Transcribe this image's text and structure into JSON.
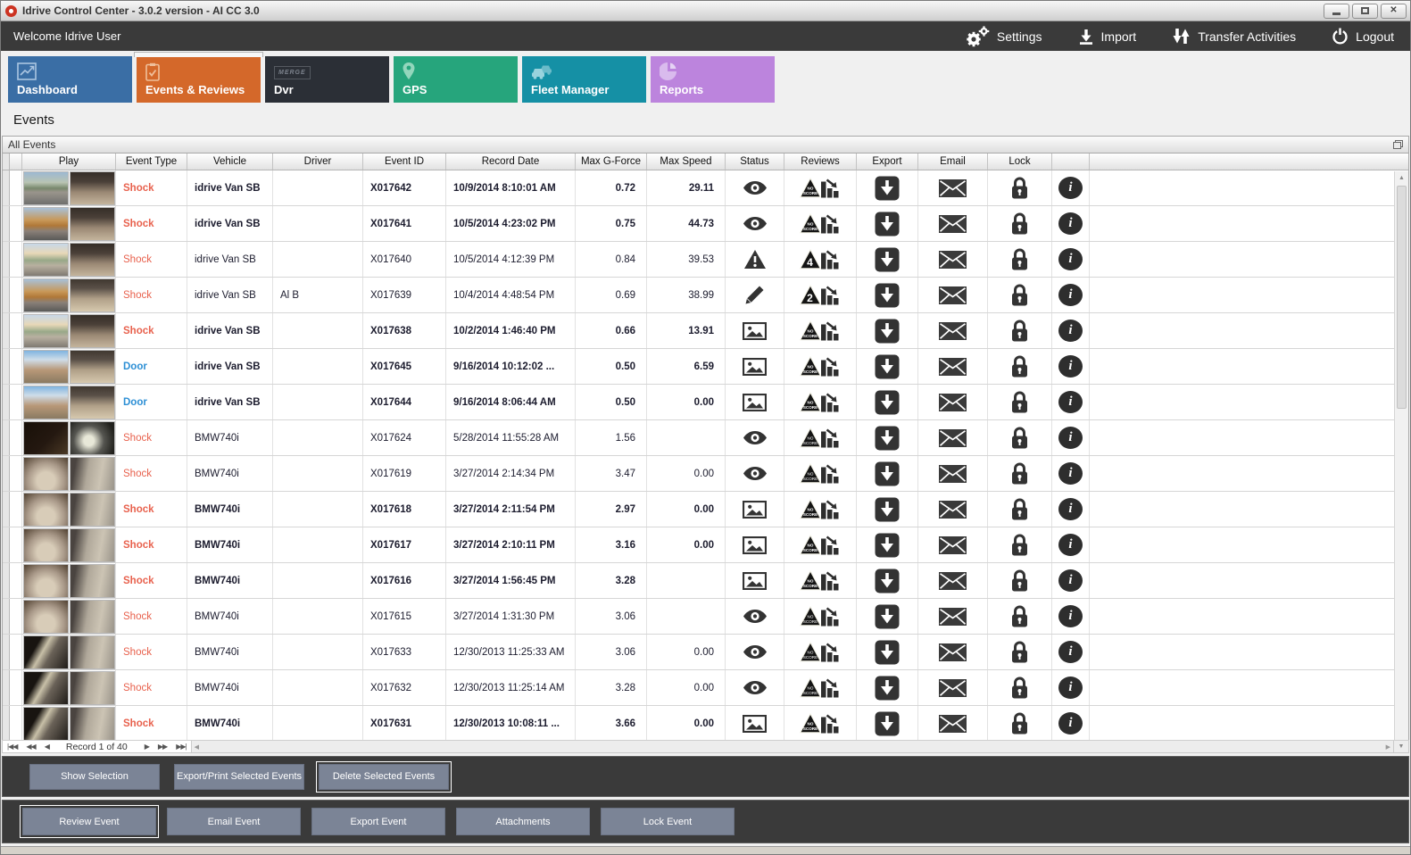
{
  "window": {
    "title": "Idrive Control Center - 3.0.2 version - AI CC 3.0",
    "controls": [
      "minimize",
      "maximize",
      "close"
    ]
  },
  "topbar": {
    "welcome": "Welcome Idrive User",
    "actions": [
      {
        "label": "Settings",
        "icon": "gears-icon"
      },
      {
        "label": "Import",
        "icon": "import-download-icon"
      },
      {
        "label": "Transfer Activities",
        "icon": "transfer-arrows-icon"
      },
      {
        "label": "Logout",
        "icon": "power-icon"
      }
    ]
  },
  "tabs": [
    {
      "label": "Dashboard",
      "icon": "line-chart-icon",
      "color": "#3a6ea5",
      "active": false
    },
    {
      "label": "Events & Reviews",
      "icon": "clipboard-check-icon",
      "color": "#d4682a",
      "active": true
    },
    {
      "label": "Dvr",
      "icon": "merge-logo-icon",
      "color": "#2b2f36",
      "active": false
    },
    {
      "label": "GPS",
      "icon": "location-pin-icon",
      "color": "#26a57c",
      "active": false
    },
    {
      "label": "Fleet Manager",
      "icon": "vehicles-icon",
      "color": "#1590a5",
      "active": false
    },
    {
      "label": "Reports",
      "icon": "pie-chart-icon",
      "color": "#bc84dd",
      "active": false
    }
  ],
  "page": {
    "heading": "Events",
    "panel_title": "All Events"
  },
  "table": {
    "columns": [
      "",
      "Play",
      "Event Type",
      "Vehicle",
      "Driver",
      "Event ID",
      "Record Date",
      "Max G-Force",
      "Max Speed",
      "Status",
      "Reviews",
      "Export",
      "Email",
      "Lock",
      ""
    ],
    "events": [
      {
        "event_type": "Shock",
        "vehicle": "idrive Van SB",
        "driver": "",
        "event_id": "X017642",
        "record_date": "10/9/2014 8:10:01 AM",
        "max_g": "0.72",
        "max_speed": "29.11",
        "status": "eye",
        "review": "NO SCORE",
        "unread": true,
        "thumbs": [
          "road-a",
          "cabin-a"
        ]
      },
      {
        "event_type": "Shock",
        "vehicle": "idrive Van SB",
        "driver": "",
        "event_id": "X017641",
        "record_date": "10/5/2014 4:23:02 PM",
        "max_g": "0.75",
        "max_speed": "44.73",
        "status": "eye",
        "review": "NO SCORE",
        "unread": true,
        "thumbs": [
          "road-b",
          "cabin-a"
        ]
      },
      {
        "event_type": "Shock",
        "vehicle": "idrive Van SB",
        "driver": "",
        "event_id": "X017640",
        "record_date": "10/5/2014 4:12:39 PM",
        "max_g": "0.84",
        "max_speed": "39.53",
        "status": "warning",
        "review": "4",
        "unread": false,
        "thumbs": [
          "road-c",
          "cabin-a"
        ]
      },
      {
        "event_type": "Shock",
        "vehicle": "idrive Van SB",
        "driver": "Al B",
        "event_id": "X017639",
        "record_date": "10/4/2014 4:48:54 PM",
        "max_g": "0.69",
        "max_speed": "38.99",
        "status": "pencil",
        "review": "2",
        "unread": false,
        "thumbs": [
          "road-b",
          "cabin-b"
        ]
      },
      {
        "event_type": "Shock",
        "vehicle": "idrive Van SB",
        "driver": "",
        "event_id": "X017638",
        "record_date": "10/2/2014 1:46:40 PM",
        "max_g": "0.66",
        "max_speed": "13.91",
        "status": "picture",
        "review": "NO SCORE",
        "unread": true,
        "thumbs": [
          "road-c",
          "cabin-a"
        ]
      },
      {
        "event_type": "Door",
        "vehicle": "idrive Van SB",
        "driver": "",
        "event_id": "X017645",
        "record_date": "9/16/2014 10:12:02 ...",
        "max_g": "0.50",
        "max_speed": "6.59",
        "status": "picture",
        "review": "NO SCORE",
        "unread": true,
        "thumbs": [
          "door-a",
          "cabin-b"
        ]
      },
      {
        "event_type": "Door",
        "vehicle": "idrive Van SB",
        "driver": "",
        "event_id": "X017644",
        "record_date": "9/16/2014 8:06:44 AM",
        "max_g": "0.50",
        "max_speed": "0.00",
        "status": "picture",
        "review": "NO SCORE",
        "unread": true,
        "thumbs": [
          "door-a",
          "cabin-b"
        ]
      },
      {
        "event_type": "Shock",
        "vehicle": "BMW740i",
        "driver": "",
        "event_id": "X017624",
        "record_date": "5/28/2014 11:55:28 AM",
        "max_g": "1.56",
        "max_speed": "",
        "status": "eye",
        "review": "NO SCORE",
        "unread": false,
        "thumbs": [
          "bmw-dark",
          "bmw-glow"
        ]
      },
      {
        "event_type": "Shock",
        "vehicle": "BMW740i",
        "driver": "",
        "event_id": "X017619",
        "record_date": "3/27/2014 2:14:34 PM",
        "max_g": "3.47",
        "max_speed": "0.00",
        "status": "eye",
        "review": "NO SCORE",
        "unread": false,
        "thumbs": [
          "bmw-grain",
          "bmw-person"
        ]
      },
      {
        "event_type": "Shock",
        "vehicle": "BMW740i",
        "driver": "",
        "event_id": "X017618",
        "record_date": "3/27/2014 2:11:54 PM",
        "max_g": "2.97",
        "max_speed": "0.00",
        "status": "picture",
        "review": "NO SCORE",
        "unread": true,
        "thumbs": [
          "bmw-grain",
          "bmw-person"
        ]
      },
      {
        "event_type": "Shock",
        "vehicle": "BMW740i",
        "driver": "",
        "event_id": "X017617",
        "record_date": "3/27/2014 2:10:11 PM",
        "max_g": "3.16",
        "max_speed": "0.00",
        "status": "picture",
        "review": "NO SCORE",
        "unread": true,
        "thumbs": [
          "bmw-grain",
          "bmw-person"
        ]
      },
      {
        "event_type": "Shock",
        "vehicle": "BMW740i",
        "driver": "",
        "event_id": "X017616",
        "record_date": "3/27/2014 1:56:45 PM",
        "max_g": "3.28",
        "max_speed": "",
        "status": "picture",
        "review": "NO SCORE",
        "unread": true,
        "thumbs": [
          "bmw-grain",
          "bmw-person"
        ]
      },
      {
        "event_type": "Shock",
        "vehicle": "BMW740i",
        "driver": "",
        "event_id": "X017615",
        "record_date": "3/27/2014 1:31:30 PM",
        "max_g": "3.06",
        "max_speed": "",
        "status": "eye",
        "review": "NO SCORE",
        "unread": false,
        "thumbs": [
          "bmw-grain",
          "bmw-person"
        ]
      },
      {
        "event_type": "Shock",
        "vehicle": "BMW740i",
        "driver": "",
        "event_id": "X017633",
        "record_date": "12/30/2013 11:25:33 AM",
        "max_g": "3.06",
        "max_speed": "0.00",
        "status": "eye",
        "review": "NO SCORE",
        "unread": false,
        "thumbs": [
          "bmw-dim",
          "bmw-person"
        ]
      },
      {
        "event_type": "Shock",
        "vehicle": "BMW740i",
        "driver": "",
        "event_id": "X017632",
        "record_date": "12/30/2013 11:25:14 AM",
        "max_g": "3.28",
        "max_speed": "0.00",
        "status": "eye",
        "review": "NO SCORE",
        "unread": false,
        "thumbs": [
          "bmw-dim",
          "bmw-person"
        ]
      },
      {
        "event_type": "Shock",
        "vehicle": "BMW740i",
        "driver": "",
        "event_id": "X017631",
        "record_date": "12/30/2013 10:08:11 ...",
        "max_g": "3.66",
        "max_speed": "0.00",
        "status": "picture",
        "review": "NO SCORE",
        "unread": true,
        "thumbs": [
          "bmw-dim",
          "bmw-person"
        ]
      }
    ]
  },
  "pager": {
    "record_text": "Record 1 of 40"
  },
  "selection_buttons": [
    {
      "label": "Show Selection",
      "focused": false
    },
    {
      "label": "Export/Print Selected Events",
      "focused": false
    },
    {
      "label": "Delete Selected  Events",
      "focused": true
    }
  ],
  "event_buttons": [
    {
      "label": "Review Event",
      "focused": true
    },
    {
      "label": "Email Event",
      "focused": false
    },
    {
      "label": "Export Event",
      "focused": false
    },
    {
      "label": "Attachments",
      "focused": false
    },
    {
      "label": "Lock Event",
      "focused": false
    }
  ],
  "colors": {
    "topbar_bg": "#3a3a3a",
    "tab_dashboard": "#3a6ea5",
    "tab_events": "#d4682a",
    "tab_dvr": "#2b2f36",
    "tab_gps": "#26a57c",
    "tab_fleet": "#1590a5",
    "tab_reports": "#bc84dd",
    "shock_text": "#e8614d",
    "door_text": "#2d8fd5",
    "button_bg": "#7b8496"
  }
}
